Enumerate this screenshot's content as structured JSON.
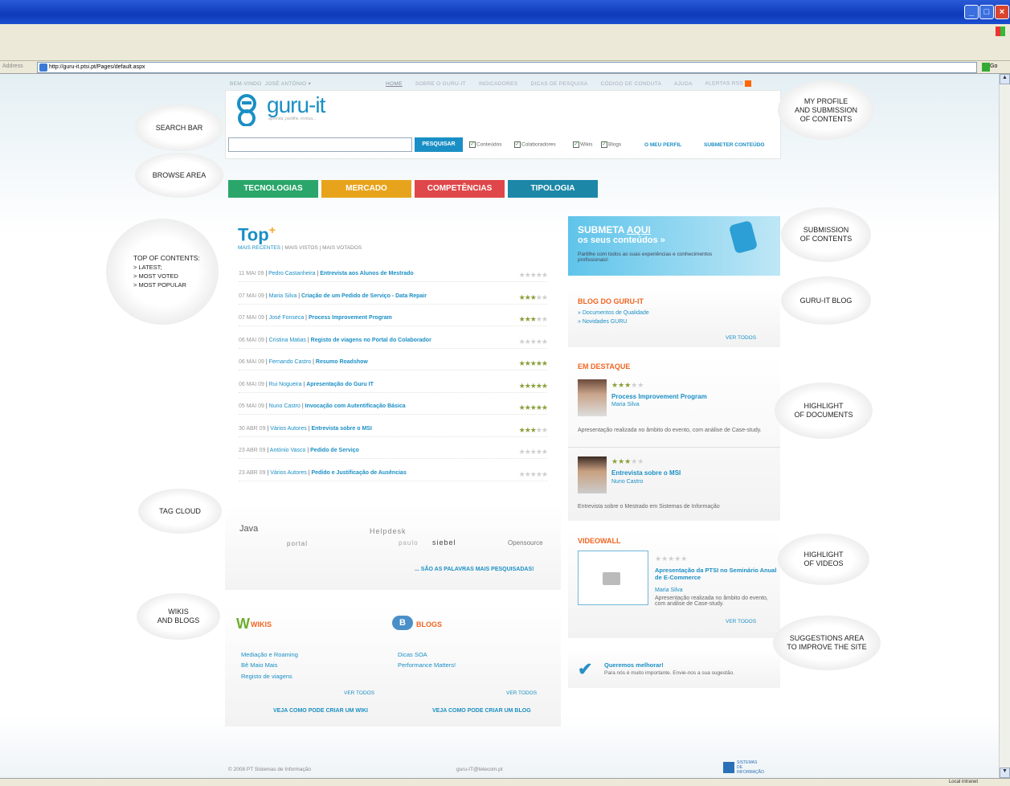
{
  "browser": {
    "address_label": "Address",
    "url": "http://guru-it.ptsi.pt/Pages/default.aspx",
    "go_label": "Go",
    "links_label": "Links",
    "status": "Local intranet"
  },
  "topnav": {
    "welcome": "BEM-VINDO",
    "user": "JOSÉ ANTÓNIO",
    "items": [
      "HOME",
      "SOBRE O GURU-IT",
      "INDICADORES",
      "DICAS DE PESQUISA",
      "CÓDIGO DE CONDUTA",
      "AJUDA",
      "ALERTAS RSS"
    ]
  },
  "logo": {
    "text": "guru-it",
    "tagline": "aprenda, partilhe, evolua..."
  },
  "search": {
    "button": "PESQUISAR",
    "filters": [
      "Conteúdos",
      "Colaboradores",
      "Wikis",
      "Blogs"
    ],
    "my_profile": "O MEU PERFIL",
    "submit": "SUBMETER CONTEÚDO"
  },
  "categories": [
    {
      "label": "TECNOLOGIAS",
      "color": "#2aa66a"
    },
    {
      "label": "MERCADO",
      "color": "#e8a31c"
    },
    {
      "label": "COMPETÊNCIAS",
      "color": "#e0474a"
    },
    {
      "label": "TIPOLOGIA",
      "color": "#1d87a8"
    }
  ],
  "top": {
    "title": "Top",
    "plus": "+",
    "tabs": [
      "MAIS RECENTES",
      "MAIS VISTOS",
      "MAIS VOTADOS"
    ],
    "rows": [
      {
        "date": "11 MAI 09",
        "author": "Pedro Castanheira",
        "title": "Entrevista aos Alunos de Mestrado",
        "stars": 0
      },
      {
        "date": "07 MAI 09",
        "author": "Maria Silva",
        "title": "Criação de um Pedido de Serviço - Data Repair",
        "stars": 3
      },
      {
        "date": "07 MAI 09",
        "author": "José Fonseca",
        "title": "Process Improvement Program",
        "stars": 3
      },
      {
        "date": "06 MAI 09",
        "author": "Cristina Matias",
        "title": "Registo de viagens no Portal do Colaborador",
        "stars": 0
      },
      {
        "date": "06 MAI 09",
        "author": "Fernando Castro",
        "title": "Resumo Roadshow",
        "stars": 4.5
      },
      {
        "date": "06 MAI 09",
        "author": "Rui Nogueira",
        "title": "Apresentação do Guru IT",
        "stars": 4.5
      },
      {
        "date": "05 MAI 09",
        "author": "Nuno Castro",
        "title": "Invocação com Autentificação Básica",
        "stars": 5
      },
      {
        "date": "30 ABR 09",
        "author": "Vários Autores",
        "title": "Entrevista sobre o MSI",
        "stars": 3
      },
      {
        "date": "23 ABR 09",
        "author": "António Vasco",
        "title": "Pedido de Serviço",
        "stars": 0
      },
      {
        "date": "23 ABR 09",
        "author": "Vários Autores",
        "title": "Pedido e Justificação de Ausências",
        "stars": 0
      }
    ]
  },
  "tagcloud": {
    "words": [
      "Java",
      "Helpdesk",
      "portal",
      "paulo",
      "siebel",
      "Opensource"
    ],
    "link": "... SÃO AS PALAVRAS MAIS PESQUISADAS!"
  },
  "wikis": {
    "title": "WIKIS",
    "items": [
      "Mediação e Roaming",
      "Bê Maio Mais",
      "Registo de viagens"
    ],
    "see_all": "VER TODOS",
    "create": "VEJA COMO PODE CRIAR UM WIKI"
  },
  "blogs": {
    "title": "BLOGS",
    "items": [
      "Dicas SOA",
      "Performance Matters!"
    ],
    "see_all": "VER TODOS",
    "create": "VEJA COMO PODE CRIAR UM BLOG"
  },
  "submit_banner": {
    "line1": "SUBMETA",
    "aqui": "AQUI",
    "line2": "os seus conteúdos »",
    "text": "Partilhe com todos as suas experiências e conhecimentos profissionais!"
  },
  "blog_guru": {
    "title": "BLOG DO GURU-IT",
    "items": [
      "» Documentos de Qualidade",
      "» Novidades GURU"
    ],
    "see_all": "VER TODOS"
  },
  "destaque": {
    "title": "EM DESTAQUE",
    "items": [
      {
        "title": "Process Improvement Program",
        "author": "Maria Silva",
        "text": "Apresentação realizada no âmbito do evento, com análise de Case-study.",
        "stars": 3
      },
      {
        "title": "Entrevista sobre o MSI",
        "author": "Nuno Castro",
        "text": "Entrevista sobre o Mestrado em Sistemas de Informação",
        "stars": 3
      }
    ]
  },
  "videowall": {
    "title": "VIDEOWALL",
    "video_title": "Apresentação da PTSI no Seminário Anual de E-Commerce",
    "author": "Maria Silva",
    "text": "Apresentação realizada no âmbito do evento, com análise de Case-study.",
    "see_all": "VER TODOS",
    "stars": 0
  },
  "suggest": {
    "title": "Queremos melhorar!",
    "text": "Para nós é muito importante. Envie-nos a sua sugestão."
  },
  "footer": {
    "copyright": "© 2008 PT Sistemas de Informação",
    "email": "guru-IT@telecom.pt",
    "logo": "SISTEMAS DE INFORMAÇÃO"
  },
  "callouts": {
    "search": "SEARCH BAR",
    "browse": "BROWSE AREA",
    "top": [
      "TOP OF CONTENTS:",
      "> LATEST;",
      "> MOST VOTED",
      "> MOST POPULAR"
    ],
    "tagcloud": "TAG CLOUD",
    "wikis": [
      "WIKIS",
      "AND BLOGS"
    ],
    "profile": [
      "MY PROFILE",
      "AND SUBMISSION",
      "OF CONTENTS"
    ],
    "submission": [
      "SUBMISSION",
      "OF CONTENTS"
    ],
    "blog": "GURU-IT BLOG",
    "documents": [
      "HIGHLIGHT",
      "OF DOCUMENTS"
    ],
    "videos": [
      "HIGHLIGHT",
      "OF VIDEOS"
    ],
    "suggestions": [
      "SUGGESTIONS AREA",
      "TO IMPROVE THE SITE"
    ]
  }
}
